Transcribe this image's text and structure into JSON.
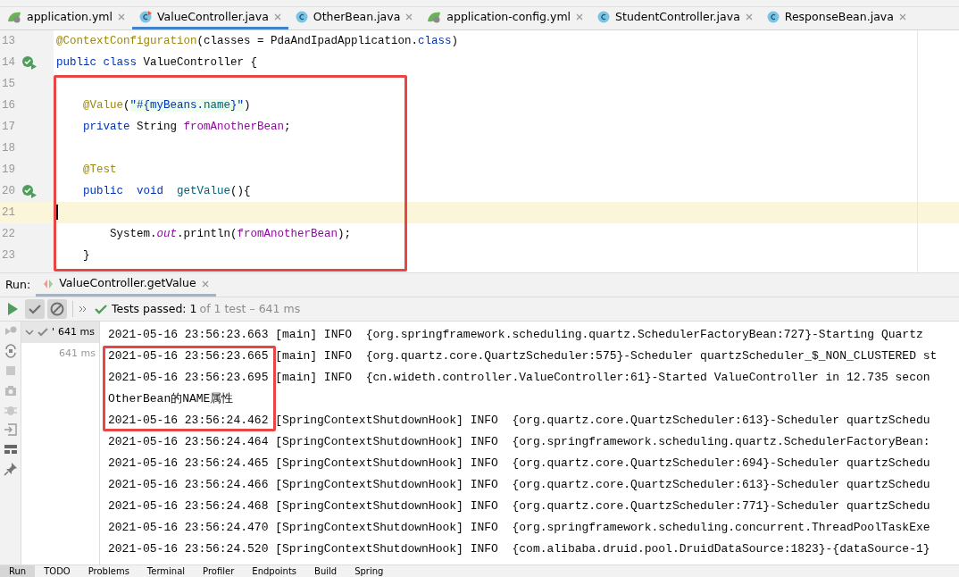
{
  "tabs": [
    {
      "label": "application.yml",
      "kind": "yaml",
      "selected": false
    },
    {
      "label": "ValueController.java",
      "kind": "test",
      "selected": true
    },
    {
      "label": "OtherBean.java",
      "kind": "java",
      "selected": false
    },
    {
      "label": "application-config.yml",
      "kind": "yaml",
      "selected": false
    },
    {
      "label": "StudentController.java",
      "kind": "java",
      "selected": false
    },
    {
      "label": "ResponseBean.java",
      "kind": "java",
      "selected": false
    }
  ],
  "editor": {
    "lines": [
      {
        "number": "13",
        "run_marker": false,
        "current": false,
        "tokens": [
          {
            "kind": "annotation",
            "text": "@ContextConfiguration"
          },
          {
            "kind": "plain",
            "text": "(classes = PdaAndIpadApplication."
          },
          {
            "kind": "keyword",
            "text": "class"
          },
          {
            "kind": "plain",
            "text": ")"
          }
        ]
      },
      {
        "number": "14",
        "run_marker": true,
        "current": false,
        "tokens": [
          {
            "kind": "keyword",
            "text": "public class "
          },
          {
            "kind": "plain",
            "text": "ValueController {"
          }
        ]
      },
      {
        "number": "15",
        "run_marker": false,
        "current": false
      },
      {
        "number": "16",
        "run_marker": false,
        "current": false,
        "tokens": [
          {
            "kind": "annotation",
            "text": "    @Value"
          },
          {
            "kind": "plain",
            "text": "("
          },
          {
            "kind": "injected",
            "text": "\"#{myBeans."
          },
          {
            "kind": "injected-member",
            "text": "name"
          },
          {
            "kind": "injected",
            "text": "}\""
          },
          {
            "kind": "plain",
            "text": ")"
          }
        ]
      },
      {
        "number": "17",
        "run_marker": false,
        "current": false,
        "tokens": [
          {
            "kind": "keyword",
            "text": "    private "
          },
          {
            "kind": "plain",
            "text": "String "
          },
          {
            "kind": "field",
            "text": "fromAnotherBean"
          },
          {
            "kind": "plain",
            "text": ";"
          }
        ]
      },
      {
        "number": "18",
        "run_marker": false,
        "current": false
      },
      {
        "number": "19",
        "run_marker": false,
        "current": false,
        "tokens": [
          {
            "kind": "annotation",
            "text": "    @Test"
          }
        ]
      },
      {
        "number": "20",
        "run_marker": true,
        "current": false,
        "tokens": [
          {
            "kind": "keyword",
            "text": "    public  void  "
          },
          {
            "kind": "method",
            "text": "getValue"
          },
          {
            "kind": "plain",
            "text": "(){"
          }
        ]
      },
      {
        "number": "21",
        "run_marker": false,
        "current": true
      },
      {
        "number": "22",
        "run_marker": false,
        "current": false,
        "tokens": [
          {
            "kind": "plain",
            "text": "        System."
          },
          {
            "kind": "static",
            "text": "out"
          },
          {
            "kind": "plain",
            "text": ".println("
          },
          {
            "kind": "field",
            "text": "fromAnotherBean"
          },
          {
            "kind": "plain",
            "text": ");"
          }
        ]
      },
      {
        "number": "23",
        "run_marker": false,
        "current": false,
        "tokens": [
          {
            "kind": "plain",
            "text": "    }"
          }
        ]
      }
    ]
  },
  "run": {
    "label": "Run:",
    "tab": "ValueController.getValue",
    "toolbar": [
      {
        "kind": "play",
        "selected": false
      },
      {
        "kind": "passed-filter",
        "selected": true
      },
      {
        "kind": "ignored-filter",
        "selected": true
      }
    ],
    "status": "Tests passed: 1",
    "detail": "of 1 test – 641 ms",
    "tree": [
      {
        "label": "'",
        "time": "641 ms",
        "selected": true,
        "expanded": true,
        "children": [
          {
            "time": "641 ms",
            "selected": false
          }
        ]
      }
    ],
    "console": [
      "2021-05-16 23:56:23.663 [main] INFO  {org.springframework.scheduling.quartz.SchedulerFactoryBean:727}-Starting Quartz",
      "2021-05-16 23:56:23.665 [main] INFO  {org.quartz.core.QuartzScheduler:575}-Scheduler quartzScheduler_$_NON_CLUSTERED st",
      "2021-05-16 23:56:23.695 [main] INFO  {cn.wideth.controller.ValueController:61}-Started ValueController in 12.735 secon",
      "OtherBean的NAME属性",
      "2021-05-16 23:56:24.462 [SpringContextShutdownHook] INFO  {org.quartz.core.QuartzScheduler:613}-Scheduler quartzSchedu",
      "2021-05-16 23:56:24.464 [SpringContextShutdownHook] INFO  {org.springframework.scheduling.quartz.SchedulerFactoryBean:",
      "2021-05-16 23:56:24.465 [SpringContextShutdownHook] INFO  {org.quartz.core.QuartzScheduler:694}-Scheduler quartzSchedu",
      "2021-05-16 23:56:24.466 [SpringContextShutdownHook] INFO  {org.quartz.core.QuartzScheduler:613}-Scheduler quartzSchedu",
      "2021-05-16 23:56:24.468 [SpringContextShutdownHook] INFO  {org.quartz.core.QuartzScheduler:771}-Scheduler quartzSchedu",
      "2021-05-16 23:56:24.470 [SpringContextShutdownHook] INFO  {org.springframework.scheduling.concurrent.ThreadPoolTaskExe",
      "2021-05-16 23:56:24.520 [SpringContextShutdownHook] INFO  {com.alibaba.druid.pool.DruidDataSource:1823}-{dataSource-1}"
    ]
  },
  "tool_windows": [
    {
      "label": "Run",
      "selected": true
    },
    {
      "label": "TODO",
      "selected": false
    },
    {
      "label": "Problems",
      "selected": false
    },
    {
      "label": "Terminal",
      "selected": false
    },
    {
      "label": "Profiler",
      "selected": false
    },
    {
      "label": "Endpoints",
      "selected": false
    },
    {
      "label": "Build",
      "selected": false
    },
    {
      "label": "Spring",
      "selected": false
    }
  ]
}
